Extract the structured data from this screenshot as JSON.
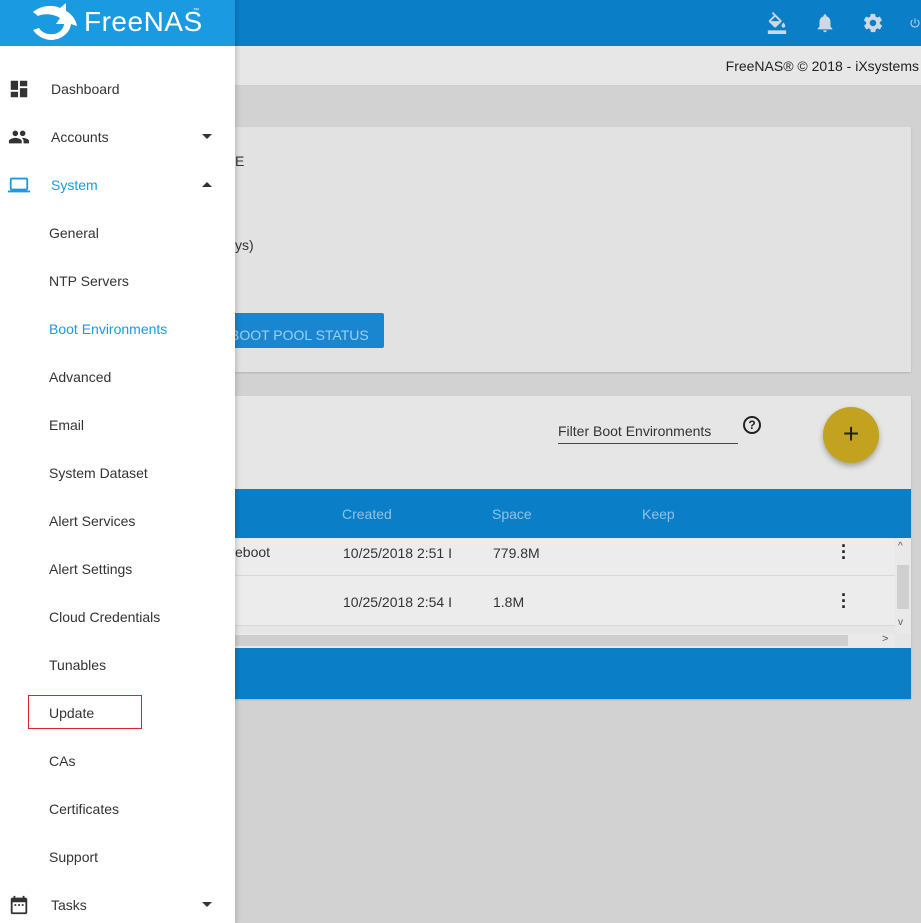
{
  "header": {
    "copyright": "FreeNAS® © 2018 - iXsystems"
  },
  "logo": {
    "name": "FreeNAS",
    "tm": "™"
  },
  "background": {
    "info_line_1": "E",
    "info_line_2": "ys)",
    "boot_pool_button": "BOOT POOL STATUS",
    "filter_placeholder": "Filter Boot Environments",
    "help_icon_glyph": "?",
    "add_glyph": "+",
    "table": {
      "columns": [
        "Created",
        "Space",
        "Keep"
      ],
      "rows": [
        {
          "name": "eboot",
          "created": "10/25/2018 2:51 I",
          "space": "779.8M",
          "keep": ""
        },
        {
          "name": "",
          "created": "10/25/2018 2:54 I",
          "space": "1.8M",
          "keep": ""
        }
      ],
      "scroll_up": "^",
      "scroll_down": "v",
      "scroll_right": ">"
    }
  },
  "sidebar": {
    "items": [
      {
        "label": "Dashboard",
        "icon": "dashboard-icon"
      },
      {
        "label": "Accounts",
        "icon": "accounts-icon"
      },
      {
        "label": "System",
        "icon": "laptop-icon"
      }
    ],
    "system_sub": [
      "General",
      "NTP Servers",
      "Boot Environments",
      "Advanced",
      "Email",
      "System Dataset",
      "Alert Services",
      "Alert Settings",
      "Cloud Credentials",
      "Tunables",
      "Update",
      "CAs",
      "Certificates",
      "Support"
    ],
    "tasks": {
      "label": "Tasks",
      "icon": "calendar-icon"
    }
  },
  "colors": {
    "topbar": "#0b7ec8",
    "logo_bg": "#1a9ae0",
    "active": "#1a9ae0",
    "highlight_box": "#d9232e",
    "fab": "#c2a21e"
  }
}
